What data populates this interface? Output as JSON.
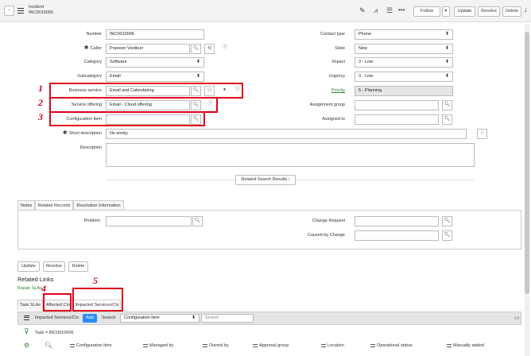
{
  "header": {
    "form_name": "Incident",
    "record_number": "INC0010006",
    "follow": "Follow",
    "update": "Update",
    "resolve": "Resolve",
    "delete": "Delete"
  },
  "left_fields": {
    "number_label": "Number",
    "number_value": "INC0010006",
    "caller_label": "Caller",
    "caller_value": "Praveen Vootkuri",
    "category_label": "Category",
    "category_value": "Software",
    "subcategory_label": "Subcategory",
    "subcategory_value": "Email",
    "business_service_label": "Business service",
    "business_service_value": "Email and Calendaring",
    "service_offering_label": "Service offering",
    "service_offering_value": "Email - Cloud offering",
    "config_item_label": "Configuration item",
    "config_item_value": "",
    "short_desc_label": "Short description",
    "short_desc_value": "No worky",
    "description_label": "Description",
    "description_value": ""
  },
  "right_fields": {
    "contact_type_label": "Contact type",
    "contact_type_value": "Phone",
    "state_label": "State",
    "state_value": "New",
    "impact_label": "Impact",
    "impact_value": "3 - Low",
    "urgency_label": "Urgency",
    "urgency_value": "3 - Low",
    "priority_label": "Priority",
    "priority_value": "5 - Planning",
    "assignment_group_label": "Assignment group",
    "assignment_group_value": "",
    "assigned_to_label": "Assigned to",
    "assigned_to_value": ""
  },
  "related_search": "Related Search Results",
  "section_tabs": [
    "Notes",
    "Related Records",
    "Resolution Information"
  ],
  "related_records": {
    "problem_label": "Problem",
    "change_request_label": "Change Request",
    "caused_by_label": "Caused by Change"
  },
  "bottom_buttons": {
    "update": "Update",
    "resolve": "Resolve",
    "delete": "Delete"
  },
  "related_links": {
    "title": "Related Links",
    "repair_slas": "Repair SLAs"
  },
  "list_tabs": [
    "Task SLAs",
    "Affected CIs",
    "Impacted Services/CIs"
  ],
  "list_toolbar": {
    "title": "Impacted Services/CIs",
    "add": "Add",
    "search_label": "Search",
    "search_field": "Configuration item",
    "search_placeholder": "Search"
  },
  "filter_text": "Task = INC0010006",
  "columns": [
    "Configuration item",
    "Managed by",
    "Owned by",
    "Approval group",
    "Location",
    "Operational status",
    "Manually added"
  ],
  "annotations": [
    "1",
    "2",
    "3",
    "4",
    "5"
  ],
  "colors": {
    "annotation": "#e0001b",
    "add_button": "#278efc",
    "priority_link": "#2e7d32"
  }
}
